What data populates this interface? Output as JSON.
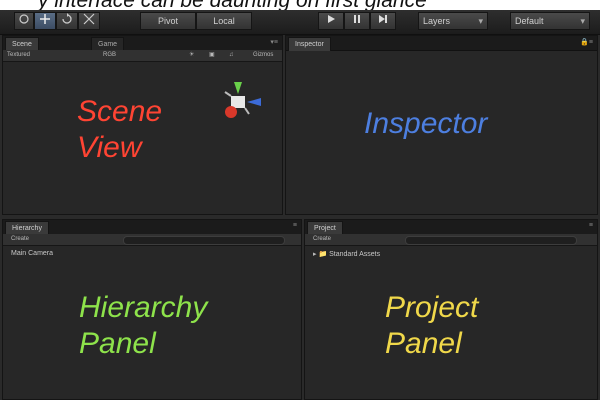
{
  "caption": "y interface can be daunting on first glance",
  "toolbar": {
    "pivot": "Pivot",
    "local": "Local",
    "play_icon": "play-icon",
    "pause_icon": "pause-icon",
    "step_icon": "step-icon",
    "layers": "Layers",
    "layout": "Default",
    "accent": "#5a6d86"
  },
  "scene": {
    "tab_scene": "Scene",
    "tab_game": "Game",
    "shading": "Textured",
    "render_mode": "RGB",
    "gizmos": "Gizmos",
    "label_line1": "Scene",
    "label_line2": "View",
    "label_color": "#ff4433"
  },
  "inspector": {
    "tab": "Inspector",
    "label": "Inspector",
    "label_color": "#4d7fe0"
  },
  "hierarchy": {
    "tab": "Hierarchy",
    "create": "Create",
    "items": [
      "Main Camera"
    ],
    "label_line1": "Hierarchy",
    "label_line2": "Panel",
    "label_color": "#8ee34b"
  },
  "project": {
    "tab": "Project",
    "create": "Create",
    "items": [
      "Standard Assets"
    ],
    "label_line1": "Project",
    "label_line2": "Panel",
    "label_color": "#f0d84a"
  }
}
